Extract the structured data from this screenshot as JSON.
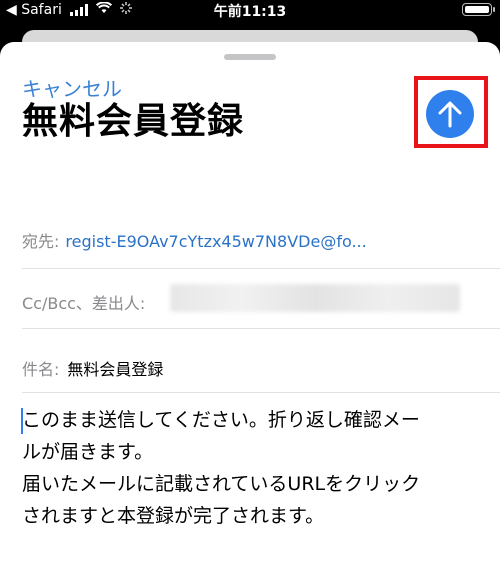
{
  "status_bar": {
    "back_app": "◀ Safari",
    "time": "午前11:13"
  },
  "compose": {
    "cancel_label": "キャンセル",
    "title": "無料会員登録",
    "to_label": "宛先:",
    "to_value": "regist-E9OAv7cYtzx45w7N8VDe@fo...",
    "ccbcc_label": "Cc/Bcc、差出人:",
    "subject_label": "件名:",
    "subject_value": "無料会員登録",
    "body_lines": [
      "このまま送信してください。折り返し確認メー",
      "ルが届きます。",
      "届いたメールに記載されているURLをクリック",
      "されますと本登録が完了されます。"
    ]
  },
  "colors": {
    "accent": "#2f80ed",
    "highlight_frame": "#e8141a",
    "link": "#2a72c8"
  },
  "icons": [
    "signal-icon",
    "wifi-icon",
    "activity-icon",
    "battery-icon",
    "send-arrow-icon"
  ]
}
